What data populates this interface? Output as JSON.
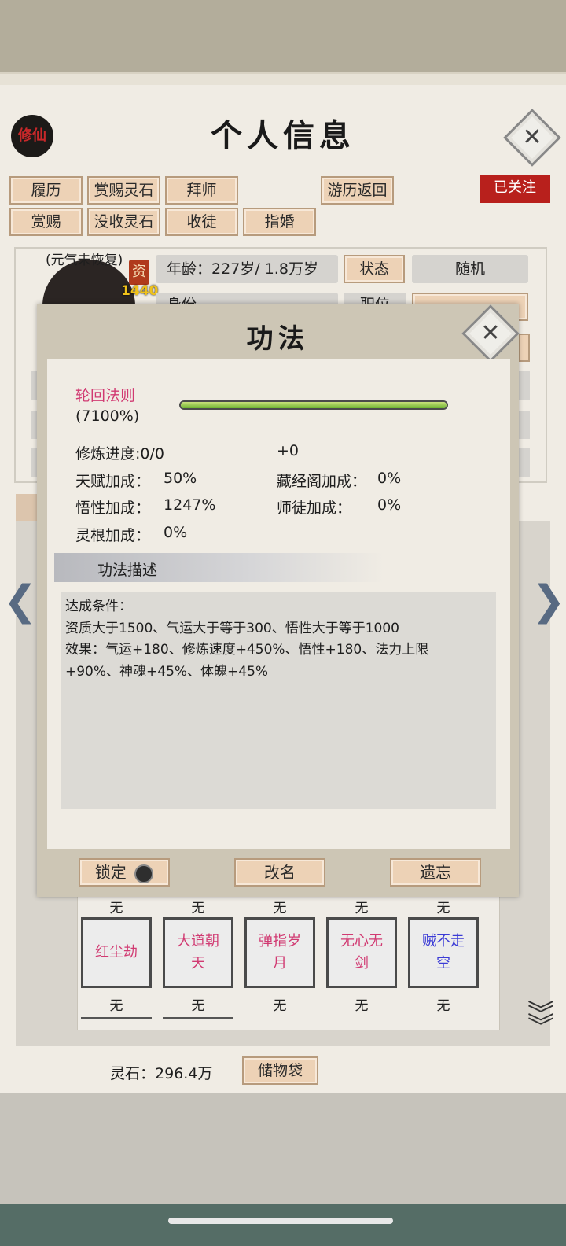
{
  "header": {
    "title": "个人信息",
    "seal_text": "修仙"
  },
  "toolbar": {
    "row1": [
      "履历",
      "赏赐灵石",
      "拜师"
    ],
    "travel_return": "游历返回",
    "followed": "已关注",
    "row2": [
      "赏赐",
      "没收灵石",
      "收徒",
      "指婚"
    ]
  },
  "profile": {
    "status_note": "(元气未恢复)",
    "tag": "资",
    "number": "1440",
    "age_label": "年龄：",
    "age_value": "227岁/ 1.8万岁",
    "state_button": "状态",
    "random_button": "随机",
    "partial_label_1": "身份",
    "partial_label_2": "职位"
  },
  "modal": {
    "title": "功法",
    "technique_name": "轮回法则",
    "technique_percent": "(7100%)",
    "progress_fraction": 1.0,
    "stats": {
      "cultivation_progress": "修炼进度:0/0",
      "bonus_plus": "+0",
      "talent_label": "天赋加成：",
      "talent_value": "50%",
      "library_label": "藏经阁加成：",
      "library_value": "0%",
      "comprehension_label": "悟性加成：",
      "comprehension_value": "1247%",
      "disciple_label": "师徒加成：",
      "disciple_value": "0%",
      "root_label": "灵根加成：",
      "root_value": "0%"
    },
    "desc_header": "功法描述",
    "desc_lines": [
      "达成条件：",
      "资质大于1500、气运大于等于300、悟性大于等于1000",
      "效果：气运+180、修炼速度+450%、悟性+180、法力上限",
      "+90%、神魂+45%、体魄+45%"
    ],
    "lock_button": "锁定",
    "rename_button": "改名",
    "forget_button": "遗忘"
  },
  "skills": {
    "top_labels": [
      "无",
      "无",
      "无",
      "无",
      "无"
    ],
    "items": [
      {
        "name": "红尘劫",
        "color": "#d13a72"
      },
      {
        "name": "大道朝天",
        "color": "#d13a72"
      },
      {
        "name": "弹指岁月",
        "color": "#d13a72"
      },
      {
        "name": "无心无剑",
        "color": "#d13a72"
      },
      {
        "name": "贼不走空",
        "color": "#3b3bd6"
      }
    ],
    "bottom_labels": [
      "无",
      "无",
      "无",
      "无",
      "无"
    ]
  },
  "footer": {
    "spirit_stone": "灵石：296.4万",
    "storage_bag": "储物袋"
  },
  "icons": [
    "close-icon",
    "arrow-left-icon",
    "arrow-right-icon",
    "double-chevron-down-icon",
    "lock-toggle-icon"
  ]
}
